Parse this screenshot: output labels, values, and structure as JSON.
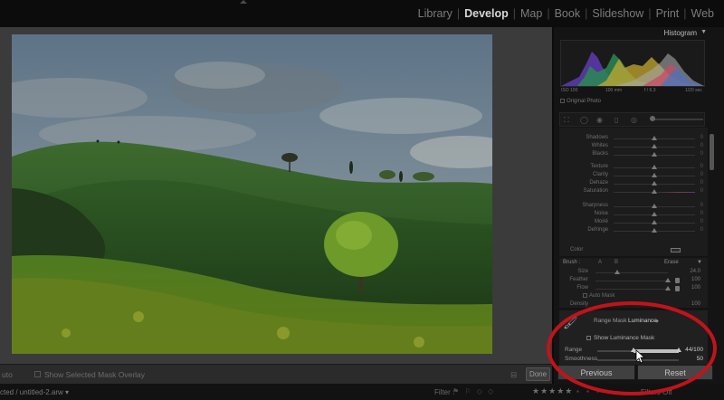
{
  "modules": [
    {
      "label": "Library",
      "active": false
    },
    {
      "label": "Develop",
      "active": true
    },
    {
      "label": "Map",
      "active": false
    },
    {
      "label": "Book",
      "active": false
    },
    {
      "label": "Slideshow",
      "active": false
    },
    {
      "label": "Print",
      "active": false
    },
    {
      "label": "Web",
      "active": false
    }
  ],
  "histogram": {
    "title": "Histogram",
    "info_left": "ISO 100",
    "info_mid1": "100 mm",
    "info_mid2": "f / 6.3",
    "info_right": "1/20 sec",
    "original_photo": "Original Photo"
  },
  "adjustments": [
    {
      "label": "Shadows",
      "pos": 0.5,
      "value": "0"
    },
    {
      "label": "Whites",
      "pos": 0.5,
      "value": "0"
    },
    {
      "label": "Blacks",
      "pos": 0.5,
      "value": "0"
    },
    {
      "label": "Texture",
      "pos": 0.5,
      "value": "0"
    },
    {
      "label": "Clarity",
      "pos": 0.5,
      "value": "0"
    },
    {
      "label": "Dehaze",
      "pos": 0.5,
      "value": "0"
    },
    {
      "label": "Saturation",
      "pos": 0.5,
      "value": "0"
    },
    {
      "label": "Sharpness",
      "pos": 0.5,
      "value": "0"
    },
    {
      "label": "Noise",
      "pos": 0.5,
      "value": "0"
    },
    {
      "label": "Moiré",
      "pos": 0.5,
      "value": "0"
    },
    {
      "label": "Defringe",
      "pos": 0.5,
      "value": "0"
    }
  ],
  "color_label": "Color",
  "brush": {
    "title": "Brush :",
    "a": "A",
    "b": "B",
    "erase": "Erase",
    "rows": [
      {
        "label": "Size",
        "pos": 0.3,
        "value": "24.0"
      },
      {
        "label": "Feather",
        "pos": 1.0,
        "value": "100"
      },
      {
        "label": "Flow",
        "pos": 1.0,
        "value": "100"
      }
    ],
    "auto_mask": "Auto Mask",
    "density_label": "Density",
    "density_value": "100"
  },
  "range_mask": {
    "label": "Range Mask :",
    "value": "Luminance",
    "show_mask": "Show Luminance Mask",
    "range_label": "Range",
    "range_low": 0.44,
    "range_high": 1.0,
    "range_value": "44/100",
    "smoothness_label": "Smoothness",
    "smoothness": 0.5,
    "smoothness_value": "50"
  },
  "buttons": {
    "previous": "Previous",
    "reset": "Reset"
  },
  "toolbar": {
    "left": "uto",
    "overlay": "Show Selected Mask Overlay",
    "done": "Done"
  },
  "filmstrip": {
    "file": "cted / untitled-2.arw ▾",
    "filter": "Filter :",
    "filter_off": "Filters Off"
  }
}
